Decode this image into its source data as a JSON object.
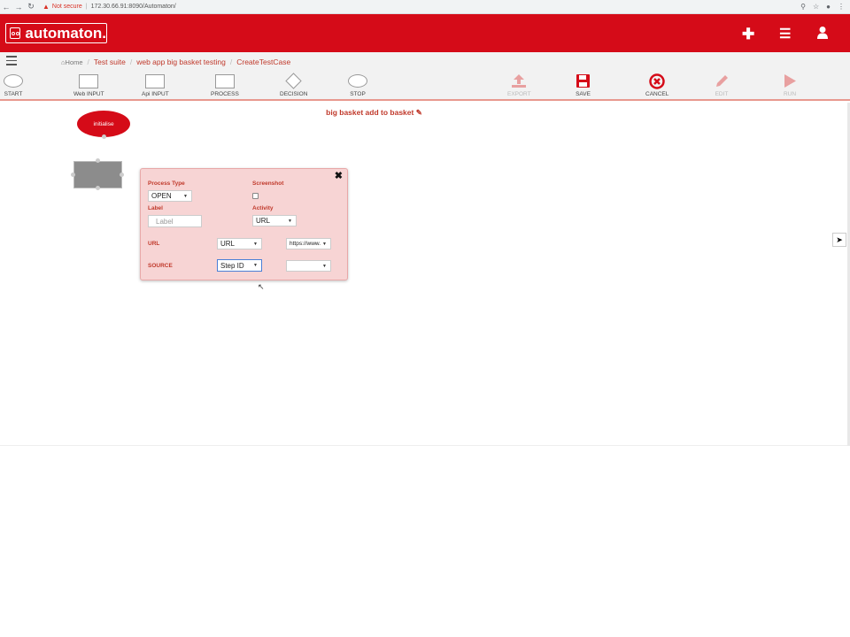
{
  "browser": {
    "not_secure": "Not secure",
    "url": "172.30.66.91:8090/Automaton/"
  },
  "header": {
    "brand": "automaton."
  },
  "breadcrumb": {
    "home": "Home",
    "items": [
      "Test suite",
      "web app big basket testing",
      "CreateTestCase"
    ]
  },
  "toolbar": {
    "shapes": [
      "START",
      "Web INPUT",
      "Api INPUT",
      "PROCESS",
      "DECISION",
      "STOP"
    ],
    "actions": {
      "export": "EXPORT",
      "save": "SAVE",
      "cancel": "CANCEL",
      "edit": "EDIT",
      "run": "RUN"
    }
  },
  "canvas": {
    "title": "big basket add to basket",
    "initialise_node": "initialise"
  },
  "popup": {
    "process_type_label": "Process Type",
    "process_type_value": "OPEN",
    "screenshot_label": "Screenshot",
    "label_label": "Label",
    "label_placeholder": "Label",
    "activity_label": "Activity",
    "activity_value": "URL",
    "url_row_label": "URL",
    "url_type_value": "URL",
    "url_value": "https://www.",
    "source_row_label": "SOURCE",
    "source_type_value": "Step ID",
    "source_value": ""
  },
  "colors": {
    "brand_red": "#d50b18",
    "label_red": "#c0392b",
    "popup_bg": "#f7d4d4"
  }
}
